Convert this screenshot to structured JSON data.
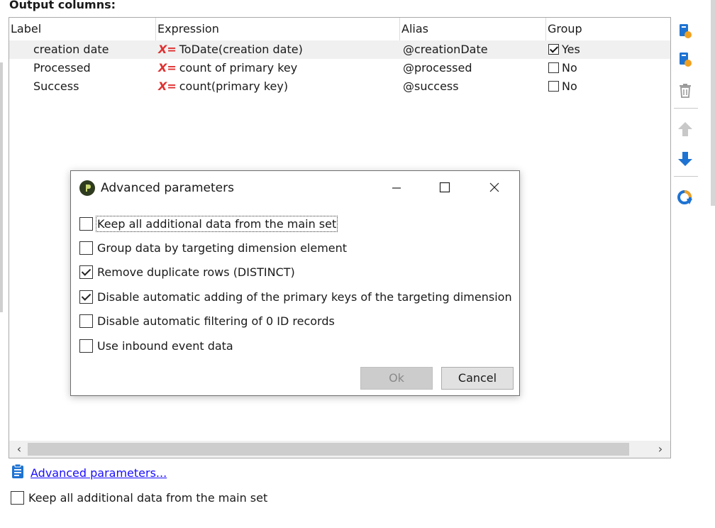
{
  "section": {
    "title": "Output columns:"
  },
  "grid": {
    "columns": [
      "Label",
      "Expression",
      "Alias",
      "Group"
    ],
    "rows": [
      {
        "label": "creation date",
        "expression": "ToDate(creation date)",
        "alias": "@creationDate",
        "group_checked": true,
        "group": "Yes",
        "selected": true
      },
      {
        "label": "Processed",
        "expression": "count of primary key",
        "alias": "@processed",
        "group_checked": false,
        "group": "No",
        "selected": false
      },
      {
        "label": "Success",
        "expression": "count(primary key)",
        "alias": "@success",
        "group_checked": false,
        "group": "No",
        "selected": false
      }
    ],
    "expression_icon": "X="
  },
  "toolbar": {
    "icons": [
      "add-column-icon",
      "edit-column-icon",
      "delete-icon",
      "move-up-icon",
      "move-down-icon",
      "distribution-icon"
    ],
    "colors": {
      "active": "#1e73d2",
      "disabled": "#b8b8b8",
      "accent": "#f0a020"
    }
  },
  "footer": {
    "advanced_link": "Advanced parameters...",
    "keep_data_label": "Keep all additional data from the main set",
    "keep_data_checked": false
  },
  "dialog": {
    "title": "Advanced parameters",
    "options": [
      {
        "label": "Keep all additional data from the main set",
        "checked": false
      },
      {
        "label": "Group data by targeting dimension element",
        "checked": false
      },
      {
        "label": "Remove duplicate rows (DISTINCT)",
        "checked": true
      },
      {
        "label": "Disable automatic adding of the primary keys of the targeting dimension",
        "checked": true
      },
      {
        "label": "Disable automatic filtering of 0 ID records",
        "checked": false
      },
      {
        "label": "Use inbound event data",
        "checked": false
      }
    ],
    "ok_label": "Ok",
    "cancel_label": "Cancel"
  }
}
